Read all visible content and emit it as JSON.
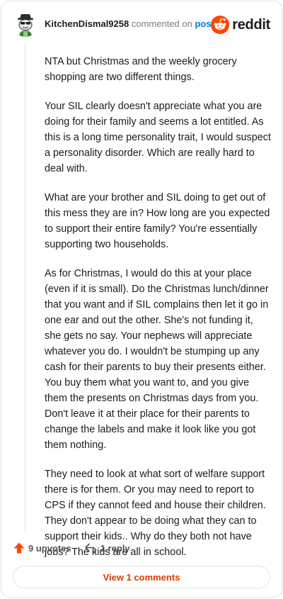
{
  "header": {
    "username": "KitchenDismal9258",
    "commented_text": "commented on",
    "post_link": "post",
    "brand": "reddit"
  },
  "comment": {
    "paragraphs": [
      "NTA but Christmas and the weekly grocery shopping are two different things.",
      "Your SIL clearly doesn't appreciate what you are doing for their family and seems a lot entitled. As this is a long time personality trait, I would suspect a personality disorder. Which are really hard to deal with.",
      "What are your brother and SIL doing to get out of this mess they are in? How long are you expected to support their entire family? You're essentially supporting two households.",
      "As for Christmas, I would do this at your place (even if it is small). Do the Christmas lunch/dinner that you want and if SIL complains then let it go in one ear and out the other. She's not funding it, she gets no say. Your nephews will appreciate whatever you do. I wouldn't be stumping up any cash for their parents to buy their presents either. You buy them what you want to, and you give them the presents on Christmas days from you. Don't leave it at their place for their parents to change the labels and make it look like you got them nothing.",
      "They need to look at what sort of welfare support there is for them. Or you may need to report to CPS if they cannot feed and house their children. They don't appear to be doing what they can to support their kids.. Why do they both not have jobs? The kids are all in school."
    ]
  },
  "actions": {
    "upvotes": "9 upvotes",
    "reply": "1 reply"
  },
  "footer": {
    "view_comments": "View 1 comments"
  },
  "icons": {
    "avatar": "snoo-avatar-icon",
    "brand": "reddit-logo-icon",
    "upvote": "upvote-arrow-icon",
    "reply": "reply-arrow-icon"
  },
  "colors": {
    "brand_orange": "#ff4500",
    "upvote_orange": "#ff4500",
    "link_blue": "#0079d3",
    "view_comments_text": "#d93a00",
    "muted_text": "#7c7c7c"
  }
}
